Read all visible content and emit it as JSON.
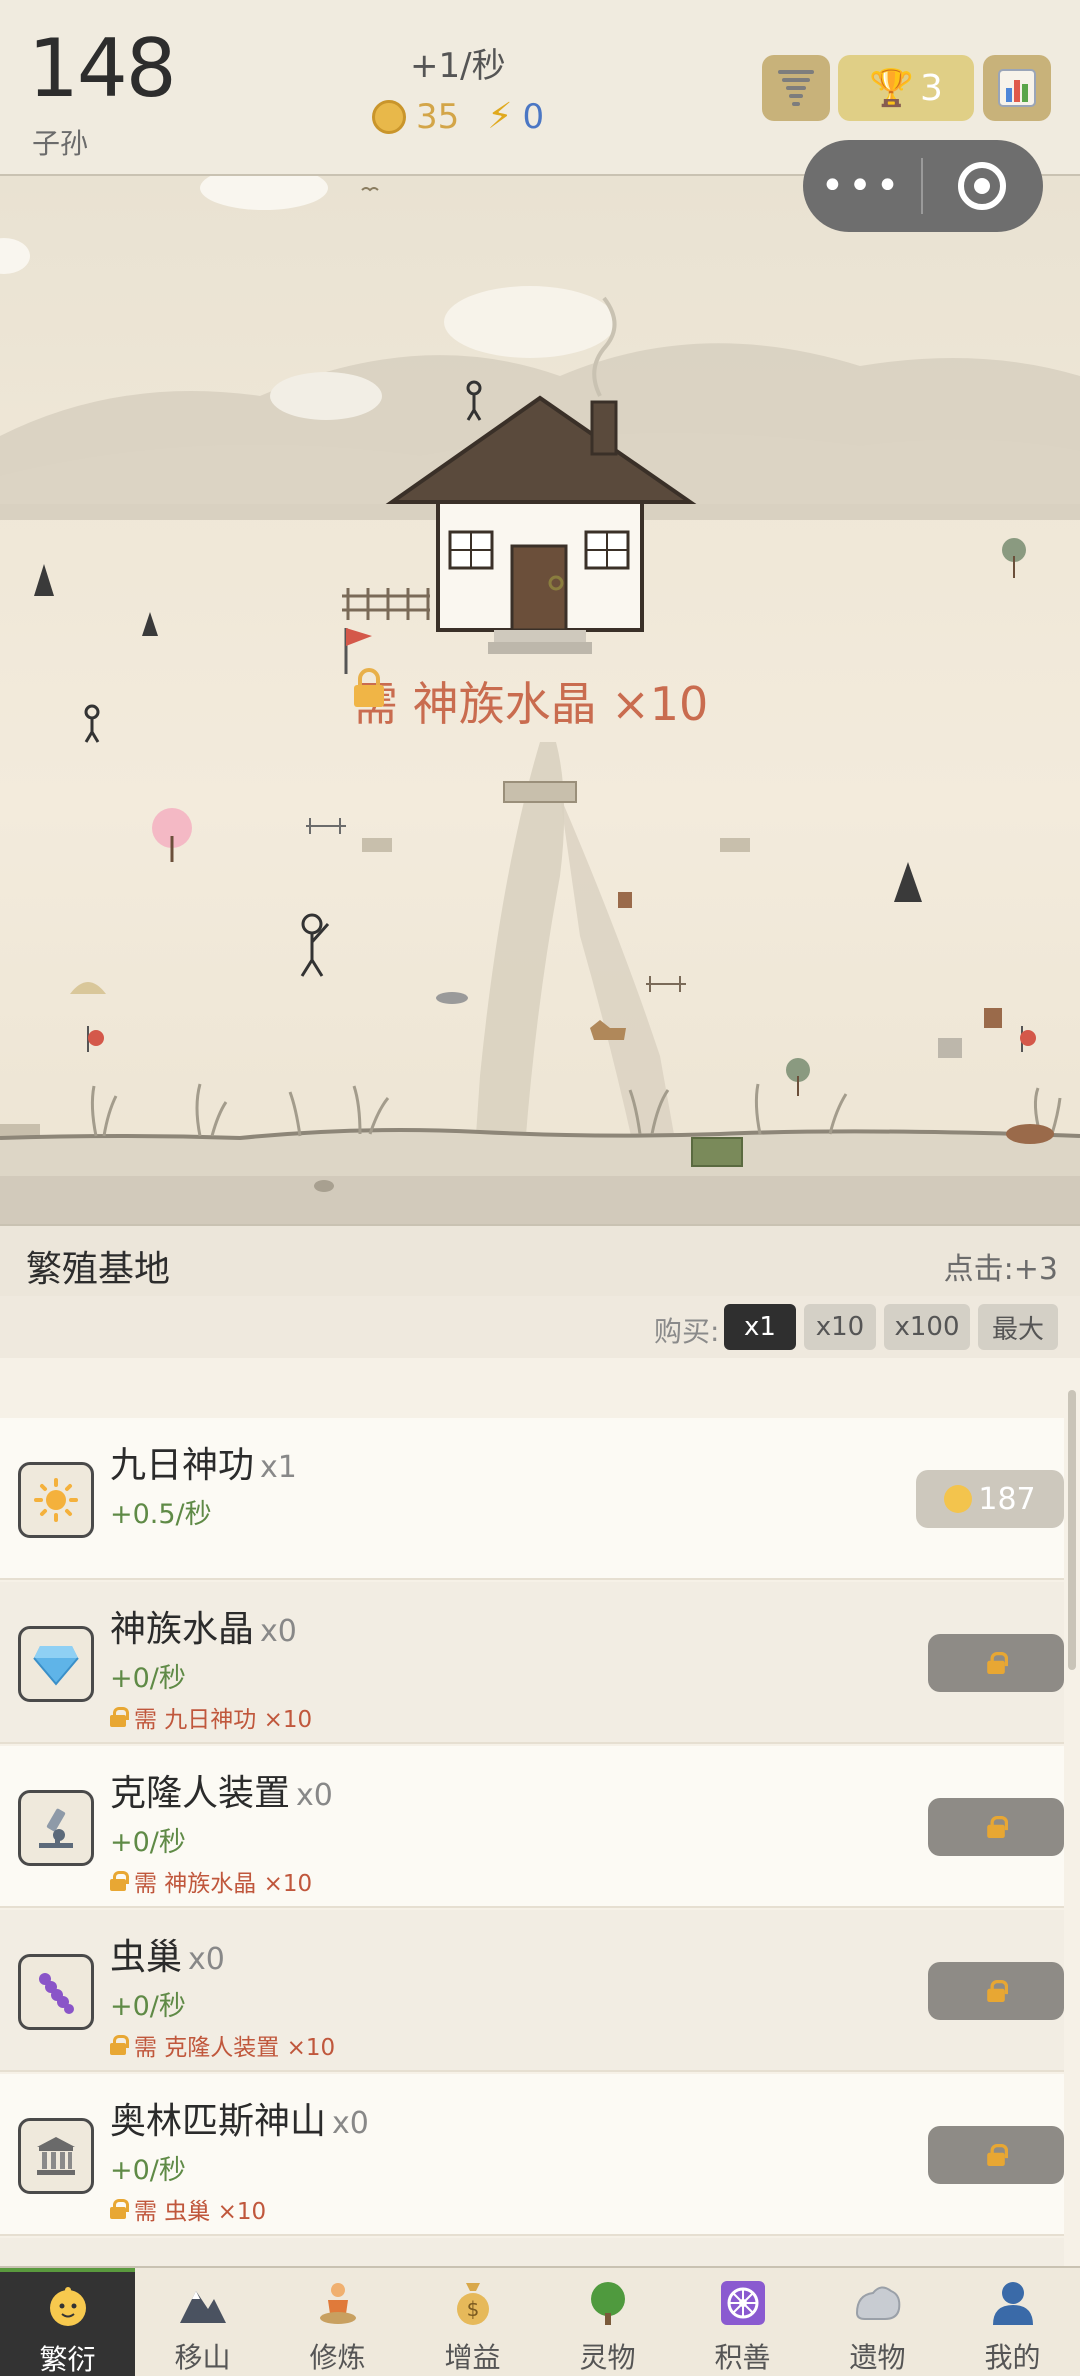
{
  "header": {
    "count": "148",
    "count_label": "子孙",
    "rate": "+1/秒",
    "coins": "35",
    "energy": "0",
    "trophy_count": "3",
    "icons": {
      "coin": "coin-icon",
      "energy": "lightning-icon",
      "tornado": "tornado-icon",
      "trophy": "trophy-icon",
      "stats": "bar-chart-icon"
    }
  },
  "capsule": {
    "more": "•••",
    "close_icon": "target-icon"
  },
  "scene": {
    "lock_text": "需 神族水晶 ×10"
  },
  "section": {
    "title": "繁殖基地",
    "click_info": "点击:+3"
  },
  "buy": {
    "label": "购买:",
    "options": [
      "x1",
      "x10",
      "x100",
      "最大"
    ],
    "selected": "x1"
  },
  "items": [
    {
      "name": "九日神功",
      "qty": "x1",
      "rate": "+0.5/秒",
      "requirement": "",
      "cost": "187",
      "locked": false,
      "icon": "sun-icon"
    },
    {
      "name": "神族水晶",
      "qty": "x0",
      "rate": "+0/秒",
      "requirement": "需 九日神功 ×10",
      "locked": true,
      "icon": "diamond-icon"
    },
    {
      "name": "克隆人装置",
      "qty": "x0",
      "rate": "+0/秒",
      "requirement": "需 神族水晶 ×10",
      "locked": true,
      "icon": "microscope-icon"
    },
    {
      "name": "虫巢",
      "qty": "x0",
      "rate": "+0/秒",
      "requirement": "需 克隆人装置 ×10",
      "locked": true,
      "icon": "worm-icon"
    },
    {
      "name": "奥林匹斯神山",
      "qty": "x0",
      "rate": "+0/秒",
      "requirement": "需 虫巢 ×10",
      "locked": true,
      "icon": "temple-icon"
    }
  ],
  "tabs": [
    {
      "label": "繁衍",
      "icon": "baby-icon",
      "active": true
    },
    {
      "label": "移山",
      "icon": "mountain-icon"
    },
    {
      "label": "修炼",
      "icon": "meditation-icon"
    },
    {
      "label": "增益",
      "icon": "money-bag-icon"
    },
    {
      "label": "灵物",
      "icon": "tree-icon"
    },
    {
      "label": "积善",
      "icon": "dharma-wheel-icon"
    },
    {
      "label": "遗物",
      "icon": "rock-icon"
    },
    {
      "label": "我的",
      "icon": "user-icon"
    }
  ]
}
